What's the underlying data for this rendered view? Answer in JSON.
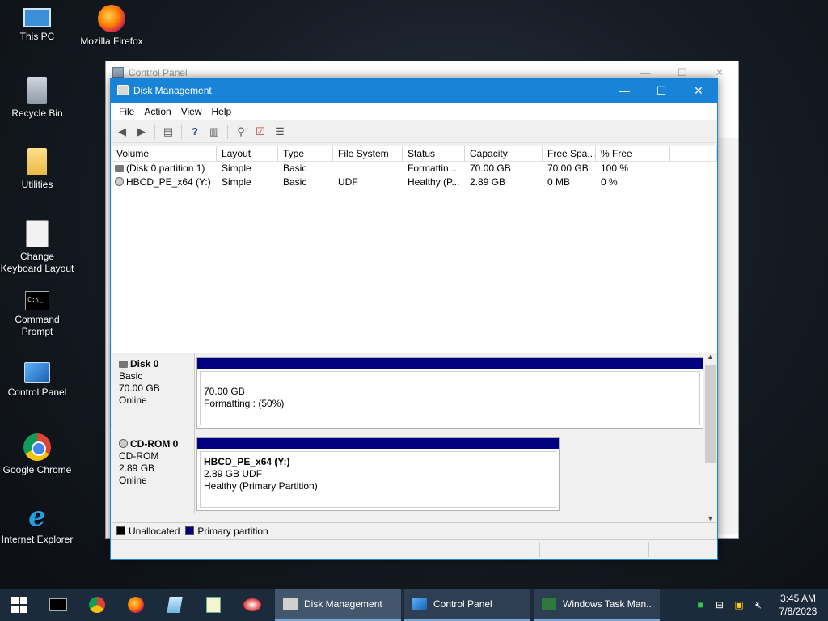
{
  "desktop": {
    "icons": [
      {
        "label": "This PC"
      },
      {
        "label": "Mozilla Firefox"
      },
      {
        "label": "Recycle Bin"
      },
      {
        "label": "Utilities"
      },
      {
        "label": "Change Keyboard Layout"
      },
      {
        "label": "Command Prompt"
      },
      {
        "label": "Control Panel"
      },
      {
        "label": "Google Chrome"
      },
      {
        "label": "Internet Explorer"
      }
    ]
  },
  "bg_window": {
    "title": "Control Panel",
    "buttons": [
      "—",
      "☐",
      "✕"
    ]
  },
  "window": {
    "title": "Disk Management",
    "buttons": [
      "—",
      "☐",
      "✕"
    ],
    "menu": [
      "File",
      "Action",
      "View",
      "Help"
    ]
  },
  "volume_table": {
    "headers": [
      "Volume",
      "Layout",
      "Type",
      "File System",
      "Status",
      "Capacity",
      "Free Spa...",
      "% Free",
      ""
    ],
    "rows": [
      {
        "volume": "(Disk 0 partition 1)",
        "layout": "Simple",
        "type": "Basic",
        "fs": "",
        "status": "Formattin...",
        "capacity": "70.00 GB",
        "free": "70.00 GB",
        "pct": "100 %"
      },
      {
        "volume": "HBCD_PE_x64 (Y:)",
        "layout": "Simple",
        "type": "Basic",
        "fs": "UDF",
        "status": "Healthy (P...",
        "capacity": "2.89 GB",
        "free": "0 MB",
        "pct": "0 %"
      }
    ]
  },
  "disks": [
    {
      "name": "Disk 0",
      "type": "Basic",
      "size": "70.00 GB",
      "state": "Online",
      "partition": {
        "title": "",
        "line1": "70.00 GB",
        "line2": "Formatting : (50%)"
      }
    },
    {
      "name": "CD-ROM 0",
      "type": "CD-ROM",
      "size": "2.89 GB",
      "state": "Online",
      "partition": {
        "title": "HBCD_PE_x64  (Y:)",
        "line1": "2.89 GB UDF",
        "line2": "Healthy (Primary Partition)"
      }
    }
  ],
  "legend": [
    {
      "label": "Unallocated",
      "color": "#000000"
    },
    {
      "label": "Primary partition",
      "color": "#000080"
    }
  ],
  "taskbar": {
    "apps": [
      {
        "label": "Disk Management",
        "active": true
      },
      {
        "label": "Control Panel",
        "active": false
      },
      {
        "label": "Windows Task Man...",
        "active": false
      }
    ],
    "time": "3:45 AM",
    "date": "7/8/2023"
  },
  "colors": {
    "titlebar": "#1883d7",
    "primary_partition": "#000080",
    "taskbar": "#1c2b3c"
  }
}
